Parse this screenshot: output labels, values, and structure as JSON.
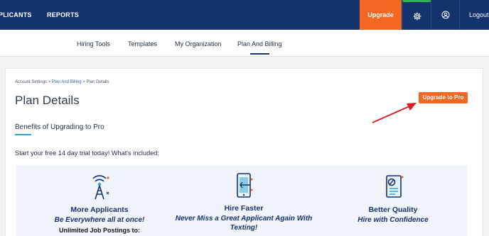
{
  "topbar": {
    "nav": [
      "PLICANTS",
      "REPORTS"
    ],
    "upgrade_label": "Upgrade",
    "settings_icon": "gear-icon",
    "profile_icon": "user-circle-icon",
    "logout_label": "Logout"
  },
  "subnav": {
    "items": [
      "Hiring Tools",
      "Templates",
      "My Organization",
      "Plan And Billing"
    ],
    "active": "Plan And Billing"
  },
  "breadcrumb": {
    "root": "Account Settings",
    "sep": ">",
    "parent": "Plan And Billing",
    "current": "Plan Details"
  },
  "page": {
    "title": "Plan Details",
    "upgrade_pro_label": "Upgrade to Pro",
    "benefits_title": "Benefits of Upgrading to Pro",
    "trial_text": "Start your free 14 day trial today! What's included:"
  },
  "features": [
    {
      "icon": "broadcast-tower-icon",
      "title": "More Applicants",
      "subtitle": "Be Everywhere all at once!",
      "detail": "Unlimited Job Postings to:"
    },
    {
      "icon": "mobile-notification-icon",
      "title": "Hire Faster",
      "subtitle": "Never Miss a Great Applicant Again With",
      "subtitle2": "Texting!"
    },
    {
      "icon": "quality-document-icon",
      "title": "Better Quality",
      "subtitle": "Hire with Confidence"
    }
  ],
  "colors": {
    "navy": "#14336b",
    "orange": "#f26722",
    "annotation_arrow": "#d61f26"
  }
}
